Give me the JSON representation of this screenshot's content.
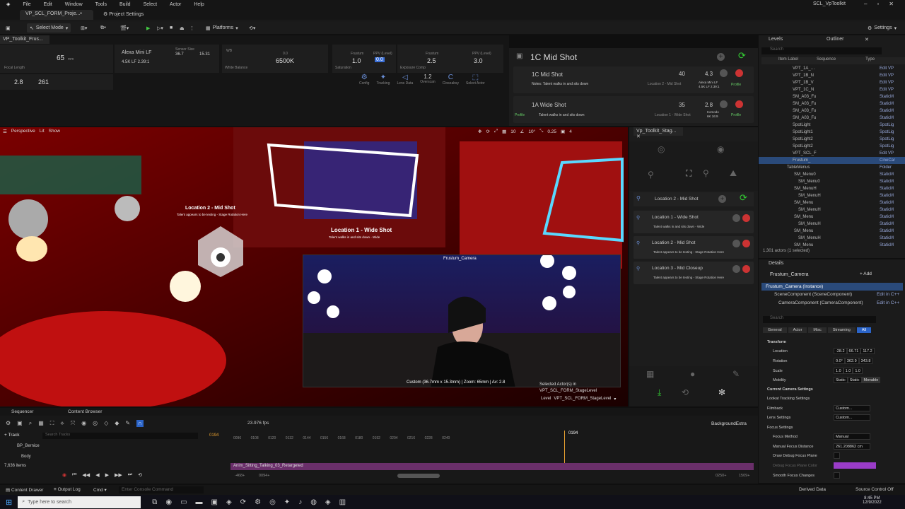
{
  "menu": [
    "File",
    "Edit",
    "Window",
    "Tools",
    "Build",
    "Select",
    "Actor",
    "Help"
  ],
  "window_title": "SCL_VpToolkit",
  "tabs": {
    "project": "VP_SCL_FORM_Proje...•",
    "settings": "Project Settings"
  },
  "toolbar": {
    "select_mode": "Select Mode",
    "platforms": "Platforms",
    "settings": "Settings"
  },
  "vcam": {
    "tab": "VP_Toolkit_Frus...",
    "focal": "65",
    "focal_unit": "mm",
    "focal_label": "Focal Length",
    "fstop": "2.8",
    "distance": "261",
    "camera": "Alexa Mini LF",
    "format": "4.5K LF 2.39:1",
    "sensor_label": "Sensor Size",
    "sensor_w": "36.7",
    "sensor_h": "15.31",
    "wb_label": "White Balance",
    "wb_short": "WB",
    "wb": "6500K",
    "tint": "0.0",
    "frustum_label": "Frustum",
    "frustum1": "1.0",
    "ppv_label": "PPV (Level)",
    "ppv1": "0.0",
    "saturation": "Saturation",
    "exposure": "Exposure Comp",
    "frustum2": "2.5",
    "ppv2": "3.0",
    "tools": [
      "Config",
      "Tracking",
      "Lens Data",
      "Overscan",
      "Closeabsy",
      "Select Actor"
    ],
    "overscan": "1.2"
  },
  "shot_panel": {
    "title": "1C Mid Shot",
    "shots": [
      {
        "name": "1C Mid Shot",
        "notes": "Notes: Talent walks in and sits down",
        "loc": "Location 2 - Mid Shot",
        "lens": "40",
        "unit": "mm",
        "fstop": "4.3",
        "cam": "Alexa Mini LF",
        "fmt": "4.5K LF 2.39:1",
        "profile": "Profile"
      },
      {
        "name": "1A Wide Shot",
        "notes": "Talent walks in and sits down",
        "loc": "Location 1 - Wide Shot",
        "lens": "35",
        "unit": "mm",
        "fstop": "2.8",
        "cam": "Komodo",
        "fmt": "6K 16:9",
        "profile": "Profile"
      }
    ]
  },
  "viewport": {
    "perspective": "Perspective",
    "lit": "Lit",
    "show": "Show",
    "grid": "10",
    "angle": "10°",
    "scale": "0.25",
    "cams": "4",
    "loc2_title": "Location 2 - Mid Shot",
    "loc2_sub": "Talent appears to be texting - Stage Rotation Here",
    "loc1_title": "Location 1 - Wide Shot",
    "loc1_sub": "Talent walks in and sits down - Wide",
    "pip_title": "Frustum_Camera",
    "pip_info": "Custom (36.7mm x 15.3mm) | Zoom: 65mm | Av: 2.8",
    "selected": "Selected Actor(s) in",
    "selected_level": "VPT_SCL_FORM_StageLevel",
    "level_label": "Level",
    "level": "VPT_SCL_FORM_StageLevel"
  },
  "stage_panel": {
    "tab": "Vp_Toolkit_Stag...",
    "current": "Location 2 - Mid Shot",
    "locations": [
      {
        "name": "Location 1 - Wide Shot",
        "desc": "Talent walks in and sits down - Wide"
      },
      {
        "name": "Location 2 - Mid Shot",
        "desc": "Talent appears to be texting - Stage Rotation Here"
      },
      {
        "name": "Location 3 - Mid Closeup",
        "desc": "Talent appears to be texting - Stage Rotation Here"
      }
    ]
  },
  "outliner": {
    "tabs": [
      "Levels",
      "Outliner"
    ],
    "search": "Search",
    "cols": [
      "Item Label",
      "Sequence",
      "Type"
    ],
    "rows": [
      {
        "l": "VPT_1A_…",
        "t": "Edit VP"
      },
      {
        "l": "VPT_1B_N",
        "t": "Edit VP"
      },
      {
        "l": "VPT_1B_V",
        "t": "Edit VP"
      },
      {
        "l": "VPT_1C_N",
        "t": "Edit VP"
      },
      {
        "l": "SM_A03_Fu",
        "t": "StaticM"
      },
      {
        "l": "SM_A03_Fu",
        "t": "StaticM"
      },
      {
        "l": "SM_A03_Fu",
        "t": "StaticM"
      },
      {
        "l": "SM_A03_Fu",
        "t": "StaticM"
      },
      {
        "l": "SpotLight",
        "t": "SpotLig"
      },
      {
        "l": "SpotLight1",
        "t": "SpotLig"
      },
      {
        "l": "SpotLight2",
        "t": "SpotLig"
      },
      {
        "l": "SpotLight2",
        "t": "SpotLig"
      },
      {
        "l": "VPT_SCL_F",
        "t": "Edit VP"
      },
      {
        "l": "Frustum_",
        "t": "CineCar"
      },
      {
        "l": "TableMenus",
        "t": "Folder"
      },
      {
        "l": "SM_Menu0",
        "t": "StaticM"
      },
      {
        "l": "SM_Menu0",
        "t": "StaticM"
      },
      {
        "l": "SM_MenuH",
        "t": "StaticM"
      },
      {
        "l": "SM_MenuH",
        "t": "StaticM"
      },
      {
        "l": "SM_Menu",
        "t": "StaticM"
      },
      {
        "l": "SM_MenuH",
        "t": "StaticM"
      },
      {
        "l": "SM_Menu",
        "t": "StaticM"
      },
      {
        "l": "SM_MenuH",
        "t": "StaticM"
      },
      {
        "l": "SM_Menu",
        "t": "StaticM"
      },
      {
        "l": "SM_MenuH",
        "t": "StaticM"
      },
      {
        "l": "SM_Menu",
        "t": "StaticM"
      }
    ],
    "count": "1,301 actors (1 selected)"
  },
  "details": {
    "tab": "Details",
    "actor": "Frustum_Camera",
    "add": "+ Add",
    "instance": "Frustum_Camera (Instance)",
    "comps": [
      {
        "n": "SceneComponent (SceneComponent)",
        "e": "Edit in C++"
      },
      {
        "n": "CameraComponent (CameraComponent)",
        "e": "Edit in C++"
      }
    ],
    "search": "Search",
    "filters": [
      "General",
      "Actor",
      "Misc",
      "Streaming",
      "All"
    ],
    "transform": "Transform",
    "location": "Location",
    "loc": [
      "-28.2",
      "66.71",
      "117.2"
    ],
    "rotation": "Rotation",
    "rot": [
      "0.0°",
      "362.9",
      "343.8"
    ],
    "scale": "Scale",
    "scl": [
      "1.0",
      "1.0",
      "1.0"
    ],
    "mobility": "Mobility",
    "mob": [
      "Static",
      "Static",
      "Movable"
    ],
    "cam_settings": "Current Camera Settings",
    "lookat": "Lookat Tracking Settings",
    "filmback": "Filmback",
    "custom": "Custom...",
    "lens": "Lens Settings",
    "focus": "Focus Settings",
    "focus_method": "Focus Method",
    "manual": "Manual",
    "mfd": "Manual Focus Distance",
    "mfd_val": "261.208862 cm",
    "draw_debug": "Draw Debug Focus Plane",
    "debug_color": "Debug Focus Plane Color",
    "smooth": "Smooth Focus Changes"
  },
  "sequencer": {
    "tabs": [
      "Sequencer",
      "Content Browser"
    ],
    "fps": "23.976 fps",
    "track": "+ Track",
    "search": "Search Tracks",
    "frame": "0194",
    "seq_name": "BackgroundExtra",
    "tracks": [
      "BP_Bernice",
      "Body"
    ],
    "items": "7,636 items",
    "ticks": [
      "0096",
      "0108",
      "0120",
      "0132",
      "0144",
      "0156",
      "0168",
      "0180",
      "0192",
      "0204",
      "0216",
      "0228",
      "0240"
    ],
    "clip": "Anim_Sitting_Talking_03_Retargeted",
    "range": [
      "-468+",
      "0094+",
      "0250+",
      "1509+"
    ]
  },
  "statusbar": {
    "content_drawer": "Content Drawer",
    "output_log": "Output Log",
    "cmd": "Cmd",
    "console": "Enter Console Command",
    "derived": "Derived Data",
    "source": "Source Control Off"
  },
  "taskbar": {
    "search": "Type here to search",
    "time": "8:45 PM",
    "date": "12/9/2022"
  }
}
